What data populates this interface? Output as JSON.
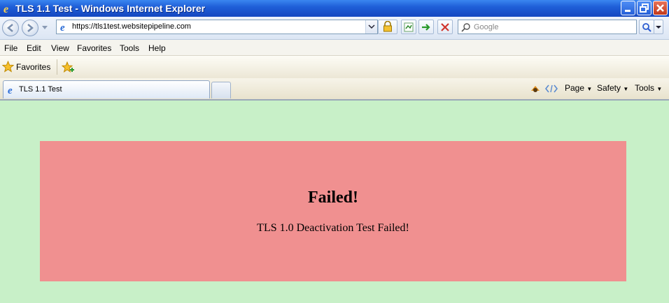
{
  "window": {
    "title": "TLS 1.1 Test - Windows Internet Explorer"
  },
  "address": {
    "url": "https://tls1test.websitepipeline.com"
  },
  "search": {
    "placeholder": "Google"
  },
  "menu": [
    "File",
    "Edit",
    "View",
    "Favorites",
    "Tools",
    "Help"
  ],
  "favorites": {
    "label": "Favorites"
  },
  "tab": {
    "title": "TLS 1.1 Test"
  },
  "commandbar": {
    "page": "Page",
    "safety": "Safety",
    "tools": "Tools"
  },
  "page": {
    "heading": "Failed!",
    "message": "TLS 1.0 Deactivation Test Failed!"
  },
  "colors": {
    "background": "#c8f0c8",
    "panel": "#f09090",
    "titlebar": "#1f5fd8"
  }
}
